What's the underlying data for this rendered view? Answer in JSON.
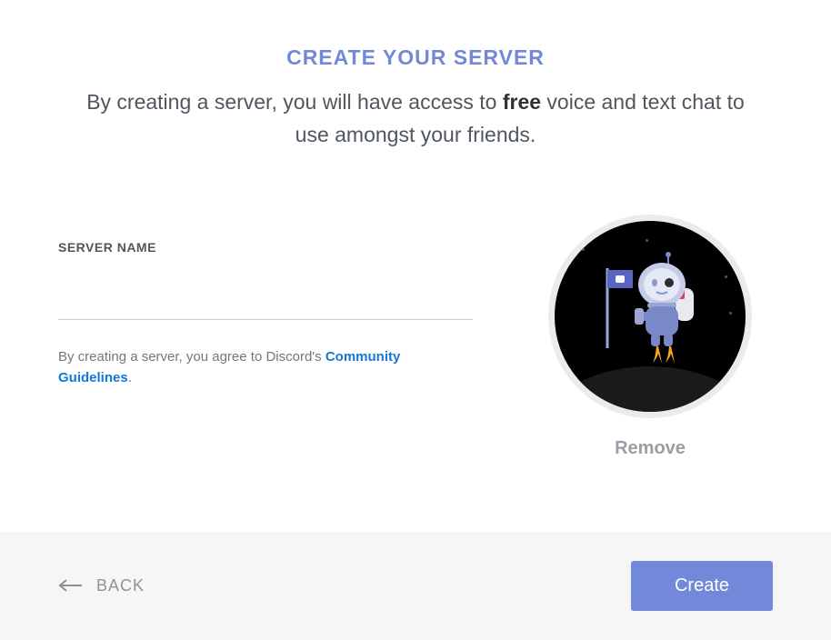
{
  "title": "CREATE YOUR SERVER",
  "description_pre": "By creating a server, you will have access to ",
  "description_bold": "free",
  "description_post": " voice and text chat to use amongst your friends.",
  "form": {
    "server_name_label": "SERVER NAME",
    "server_name_value": "",
    "tos_text": "By creating a server, you agree to Discord's ",
    "tos_link_text": "Community Guidelines",
    "tos_suffix": "."
  },
  "icon": {
    "remove_label": "Remove"
  },
  "footer": {
    "back_label": "BACK",
    "create_label": "Create"
  }
}
